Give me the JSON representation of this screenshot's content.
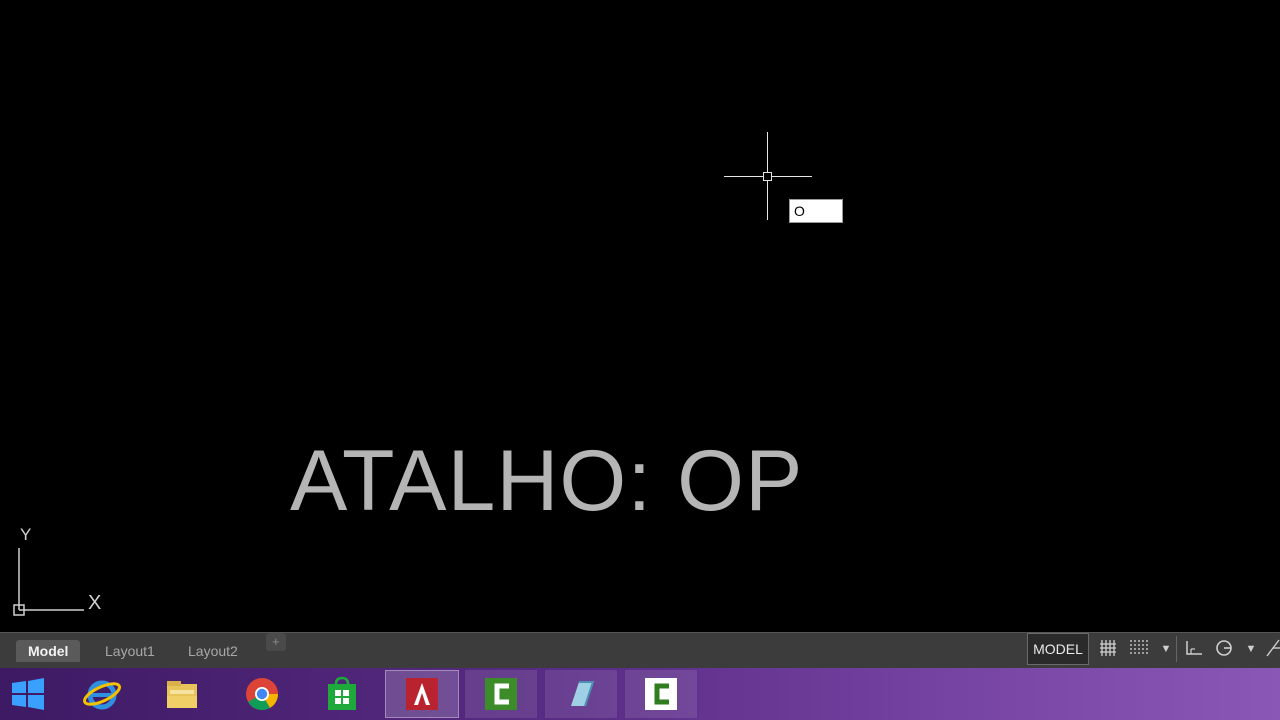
{
  "canvas": {
    "command_input_value": "O",
    "caption": "ATALHO: OP"
  },
  "ucs": {
    "y_label": "Y",
    "x_label": "X"
  },
  "tabs": [
    {
      "label": "Model",
      "active": true
    },
    {
      "label": "Layout1",
      "active": false
    },
    {
      "label": "Layout2",
      "active": false
    },
    {
      "label": "+",
      "active": false
    }
  ],
  "status": {
    "model_label": "MODEL"
  },
  "taskbar": {
    "items": [
      {
        "name": "start-icon"
      },
      {
        "name": "internet-explorer-icon"
      },
      {
        "name": "file-explorer-icon"
      },
      {
        "name": "chrome-icon"
      },
      {
        "name": "store-icon"
      },
      {
        "name": "autocad-icon"
      },
      {
        "name": "camtasia-recorder-icon"
      },
      {
        "name": "app-icon"
      },
      {
        "name": "camtasia-studio-icon"
      }
    ]
  },
  "colors": {
    "canvas_bg": "#000000",
    "caption": "#b5b5b5",
    "taskbar_accent": "#5a2c86"
  }
}
